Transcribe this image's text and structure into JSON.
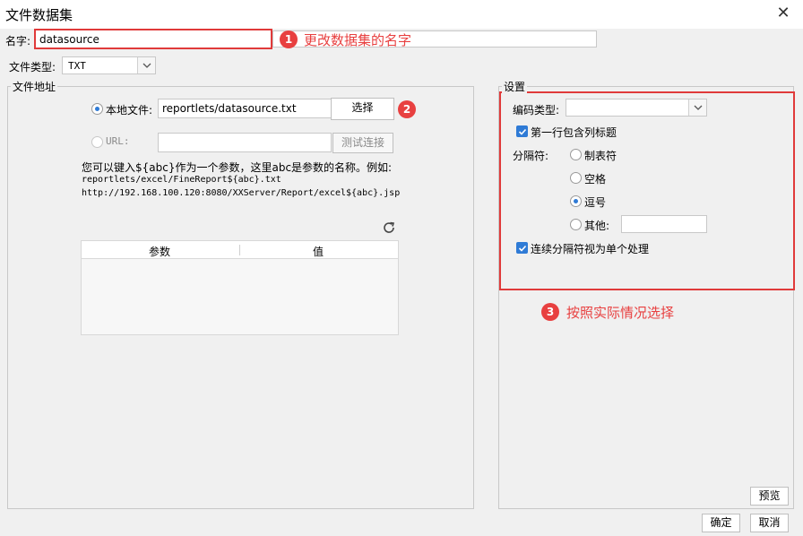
{
  "window": {
    "title": "文件数据集"
  },
  "name": {
    "label": "名字:",
    "value": "datasource"
  },
  "annotations": [
    {
      "num": "1",
      "text": "更改数据集的名字"
    },
    {
      "num": "2"
    },
    {
      "num": "3",
      "text": "按照实际情况选择"
    }
  ],
  "file_type": {
    "label": "文件类型:",
    "value": "TXT"
  },
  "file_address": {
    "legend": "文件地址",
    "local_label": "本地文件:",
    "local_value": "reportlets/datasource.txt",
    "choose_btn": "选择",
    "url_label": "URL:",
    "url_value": "",
    "test_btn": "测试连接",
    "help_line1": "您可以键入${abc}作为一个参数，这里abc是参数的名称。例如:",
    "help_line2": "reportlets/excel/FineReport${abc}.txt",
    "help_line3": "http://192.168.100.120:8080/XXServer/Report/excel${abc}.jsp",
    "table_headers": [
      "参数",
      "值"
    ]
  },
  "settings": {
    "legend": "设置",
    "encoding_label": "编码类型:",
    "encoding_value": "",
    "first_row_header": "第一行包含列标题",
    "delimiter_label": "分隔符:",
    "delimiters": [
      "制表符",
      "空格",
      "逗号",
      "其他:"
    ],
    "other_value": "",
    "consecutive": "连续分隔符视为单个处理"
  },
  "buttons": {
    "preview": "预览",
    "ok": "确定",
    "cancel": "取消"
  },
  "colors": {
    "accent": "#2f7bd6",
    "annotation_red": "#e84040"
  }
}
